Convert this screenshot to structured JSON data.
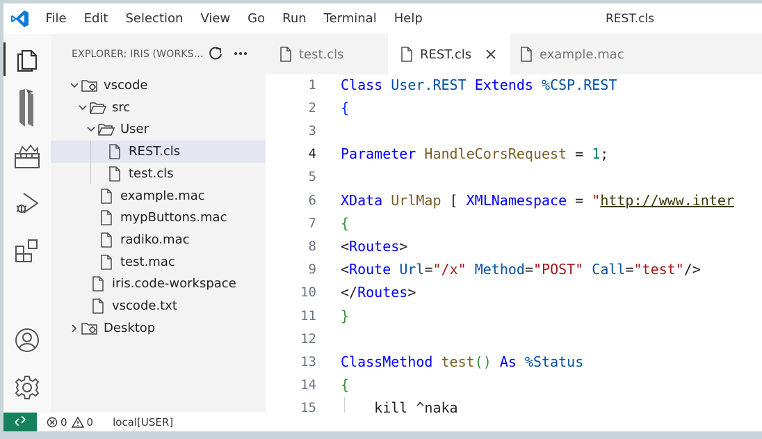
{
  "menu": [
    "File",
    "Edit",
    "Selection",
    "View",
    "Go",
    "Run",
    "Terminal",
    "Help"
  ],
  "window_title": "REST.cls",
  "activity_bar": [
    "files-icon",
    "intersystems-icon",
    "objectscript-explorer-icon",
    "run-debug-icon",
    "extensions-icon",
    "account-icon",
    "manage-gear-icon"
  ],
  "explorer": {
    "title": "EXPLORER: IRIS (WORKS...",
    "tree": [
      {
        "label": "vscode",
        "depth": 0,
        "type": "root-folder",
        "expanded": true
      },
      {
        "label": "src",
        "depth": 1,
        "type": "folder",
        "expanded": true
      },
      {
        "label": "User",
        "depth": 2,
        "type": "folder",
        "expanded": true
      },
      {
        "label": "REST.cls",
        "depth": 3,
        "type": "file",
        "selected": true
      },
      {
        "label": "test.cls",
        "depth": 3,
        "type": "file"
      },
      {
        "label": "example.mac",
        "depth": 2,
        "type": "file"
      },
      {
        "label": "mypButtons.mac",
        "depth": 2,
        "type": "file"
      },
      {
        "label": "radiko.mac",
        "depth": 2,
        "type": "file"
      },
      {
        "label": "test.mac",
        "depth": 2,
        "type": "file"
      },
      {
        "label": "iris.code-workspace",
        "depth": 1,
        "type": "file"
      },
      {
        "label": "vscode.txt",
        "depth": 1,
        "type": "file"
      },
      {
        "label": "Desktop",
        "depth": 0,
        "type": "root-folder",
        "expanded": false
      }
    ]
  },
  "tabs": [
    {
      "label": "test.cls",
      "active": false
    },
    {
      "label": "REST.cls",
      "active": true
    },
    {
      "label": "example.mac",
      "active": false
    }
  ],
  "editor": {
    "current_line": 4,
    "lines": [
      {
        "n": "1",
        "tokens": [
          [
            "kw",
            "Class"
          ],
          [
            "pl",
            " "
          ],
          [
            "cls",
            "User.REST"
          ],
          [
            "pl",
            " "
          ],
          [
            "kw",
            "Extends"
          ],
          [
            "pl",
            " "
          ],
          [
            "cls",
            "%CSP.REST"
          ]
        ]
      },
      {
        "n": "2",
        "tokens": [
          [
            "br",
            "{"
          ]
        ]
      },
      {
        "n": "3",
        "tokens": []
      },
      {
        "n": "4",
        "tokens": [
          [
            "kw",
            "Parameter"
          ],
          [
            "pl",
            " "
          ],
          [
            "id",
            "HandleCorsRequest"
          ],
          [
            "pl",
            " = "
          ],
          [
            "num",
            "1"
          ],
          [
            "pl",
            ";"
          ]
        ]
      },
      {
        "n": "5",
        "tokens": []
      },
      {
        "n": "6",
        "tokens": [
          [
            "kw",
            "XData"
          ],
          [
            "pl",
            " "
          ],
          [
            "id",
            "UrlMap"
          ],
          [
            "pl",
            " [ "
          ],
          [
            "kw",
            "XMLNamespace"
          ],
          [
            "pl",
            " = "
          ],
          [
            "str",
            "\""
          ],
          [
            "url",
            "http://www.inter"
          ]
        ]
      },
      {
        "n": "7",
        "tokens": [
          [
            "brg",
            "{"
          ]
        ]
      },
      {
        "n": "8",
        "tokens": [
          [
            "pl",
            "<"
          ],
          [
            "tag",
            "Routes"
          ],
          [
            "pl",
            ">"
          ]
        ]
      },
      {
        "n": "9",
        "tokens": [
          [
            "pl",
            "<"
          ],
          [
            "tag",
            "Route"
          ],
          [
            "pl",
            " "
          ],
          [
            "attr",
            "Url"
          ],
          [
            "pl",
            "="
          ],
          [
            "str",
            "\"/x\""
          ],
          [
            "pl",
            " "
          ],
          [
            "attr",
            "Method"
          ],
          [
            "pl",
            "="
          ],
          [
            "str",
            "\"POST\""
          ],
          [
            "pl",
            " "
          ],
          [
            "attr",
            "Call"
          ],
          [
            "pl",
            "="
          ],
          [
            "str",
            "\"test\""
          ],
          [
            "pl",
            "/>"
          ]
        ]
      },
      {
        "n": "10",
        "tokens": [
          [
            "pl",
            "</"
          ],
          [
            "tag",
            "Routes"
          ],
          [
            "pl",
            ">"
          ]
        ]
      },
      {
        "n": "11",
        "tokens": [
          [
            "brg",
            "}"
          ]
        ]
      },
      {
        "n": "12",
        "tokens": []
      },
      {
        "n": "13",
        "tokens": [
          [
            "kw",
            "ClassMethod"
          ],
          [
            "pl",
            " "
          ],
          [
            "id",
            "test"
          ],
          [
            "brg",
            "()"
          ],
          [
            "pl",
            " "
          ],
          [
            "kw",
            "As"
          ],
          [
            "pl",
            " "
          ],
          [
            "cls",
            "%Status"
          ]
        ]
      },
      {
        "n": "14",
        "tokens": [
          [
            "brg",
            "{"
          ]
        ]
      },
      {
        "n": "15",
        "tokens": [
          [
            "pl",
            "    kill ^naka"
          ]
        ],
        "indent_guide": true
      }
    ]
  },
  "status": {
    "errors": "0",
    "warnings": "0",
    "connection": "local[USER]"
  },
  "colors": {
    "accent": "#007acc",
    "remote_bg": "#16825d",
    "selection": "#e4e6f1"
  }
}
